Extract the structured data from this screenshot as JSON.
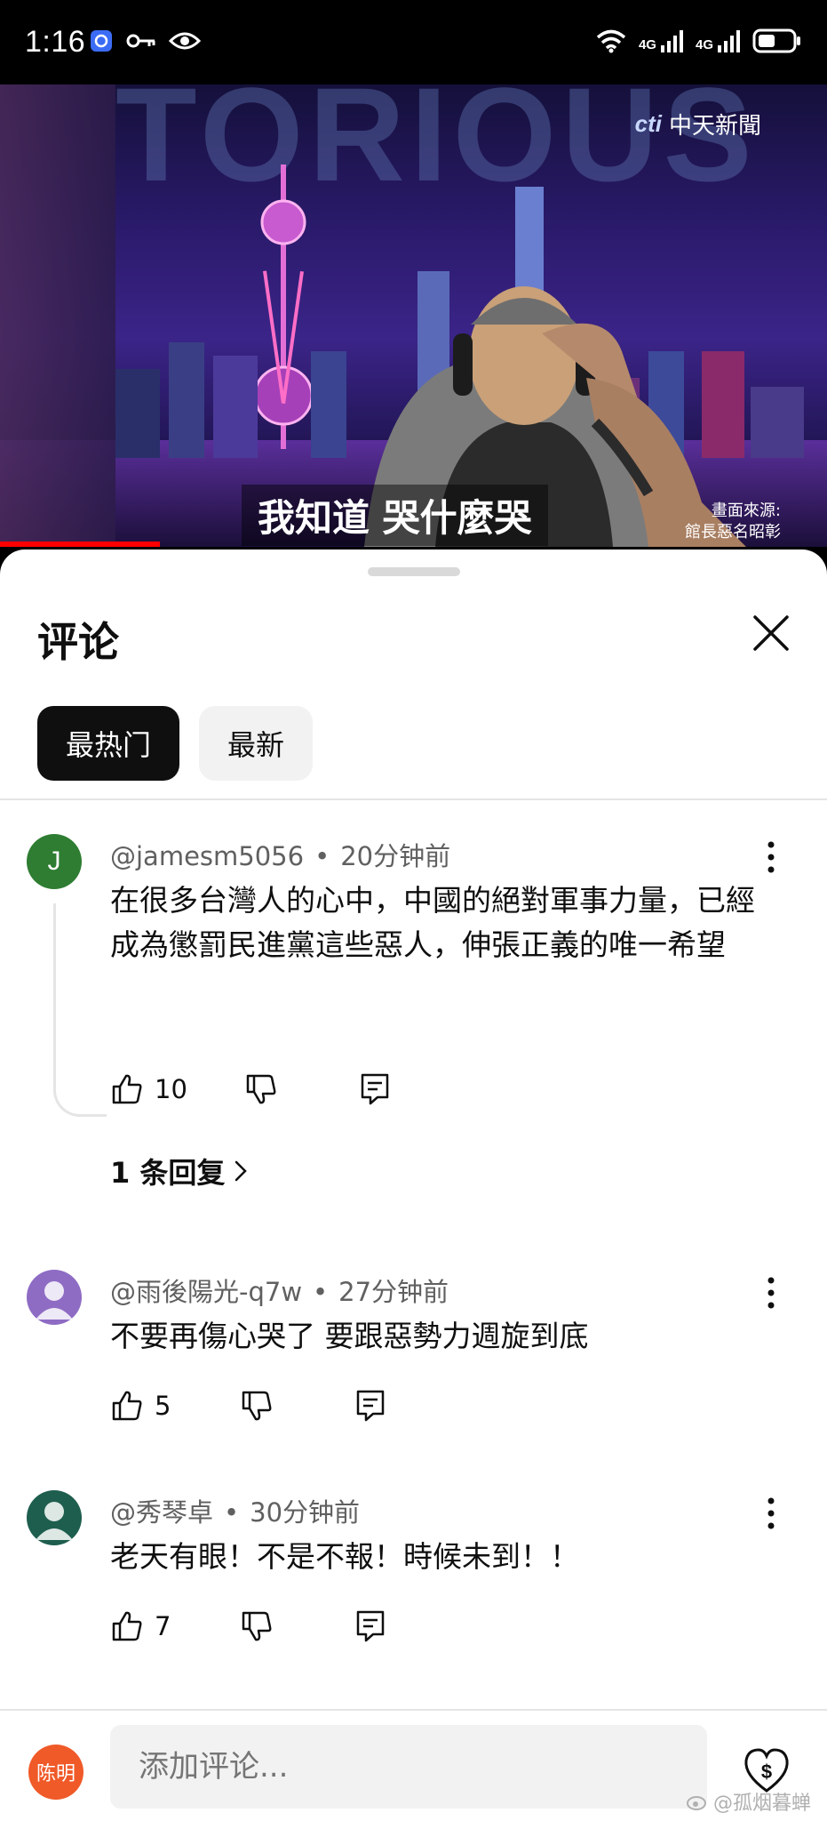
{
  "status_bar": {
    "time": "1:16",
    "network_1": "4G",
    "network_2": "4G"
  },
  "video": {
    "background_text": "TORIOUS",
    "channel_logo": "cti",
    "channel_name": "中天新聞",
    "subtitle": "我知道 哭什麼哭",
    "source_line1": "畫面來源:",
    "source_line2": "館長惡名昭彰"
  },
  "sheet": {
    "title": "评论",
    "tabs": [
      {
        "label": "最热门",
        "active": true
      },
      {
        "label": "最新",
        "active": false
      }
    ]
  },
  "comments": [
    {
      "avatar_letter": "J",
      "avatar_color": "#2e7d32",
      "author": "@jamesm5056",
      "time": "20分钟前",
      "text": "在很多台灣人的心中，中國的絕對軍事力量，已經成為懲罰民進黨這些惡人，伸張正義的唯一希望",
      "likes": "10",
      "replies": "1 条回复"
    },
    {
      "avatar_letter": "",
      "avatar_color": "#8e6cc4",
      "author": "@雨後陽光-q7w",
      "time": "27分钟前",
      "text": "不要再傷心哭了 要跟惡勢力週旋到底",
      "likes": "5"
    },
    {
      "avatar_letter": "",
      "avatar_color": "#1e5e4e",
      "author": "@秀琴卓",
      "time": "30分钟前",
      "text": "老天有眼！不是不報！時候未到！！",
      "likes": "7"
    }
  ],
  "composer": {
    "my_avatar_text": "陈明",
    "placeholder": "添加评论..."
  },
  "watermark": "@孤烟暮蝉",
  "colors": {
    "accent_red": "#ff0000",
    "chip_active_bg": "#0f0f0f",
    "chip_bg": "#f2f2f2",
    "my_avatar": "#f05a28"
  }
}
